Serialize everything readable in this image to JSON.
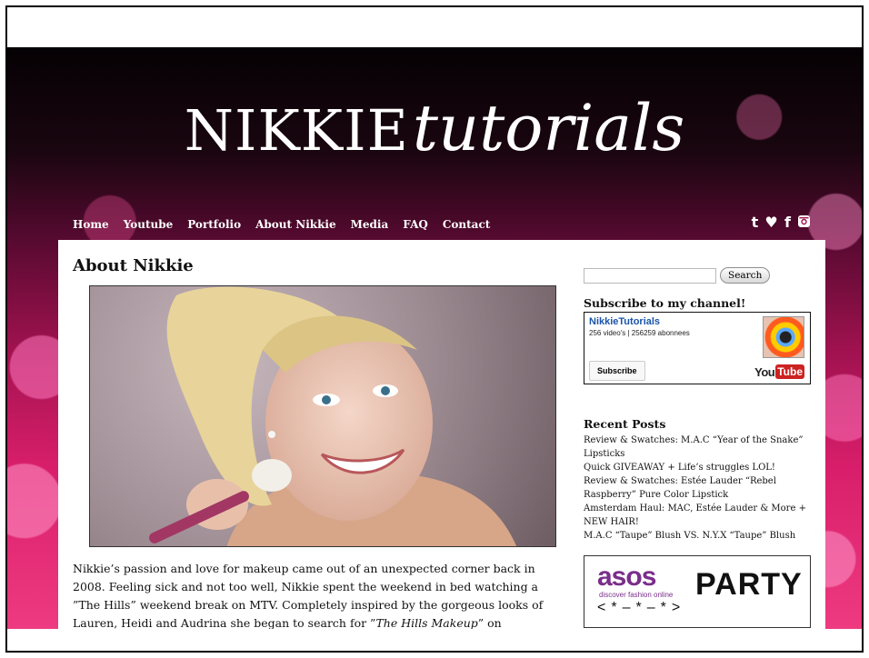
{
  "header": {
    "logo_caps": "NIKKIE",
    "logo_script": "tutorials"
  },
  "nav": [
    "Home",
    "Youtube",
    "Portfolio",
    "About Nikkie",
    "Media",
    "FAQ",
    "Contact"
  ],
  "social_icons": [
    "tumblr-icon",
    "heart-icon",
    "facebook-icon",
    "instagram-icon"
  ],
  "post": {
    "title": "About Nikkie",
    "body_intro": "Nikkie’s passion and love for makeup came out of an unexpected corner back in 2008. Feeling sick and not too well, Nikkie spent the weekend in bed watching a ”The Hills” weekend break on MTV. Completely inspired by the gorgeous looks of Lauren, Heidi and Audrina she began to search for ”",
    "body_italic": "The Hills Makeup",
    "body_end": "” on YouTube."
  },
  "sidebar": {
    "search_button": "Search",
    "subscribe_title": "Subscribe to my channel!",
    "youtube": {
      "channel_name": "NikkieTutorials",
      "stats": "256 video's | 256259 abonnees",
      "subscribe_label": "Subscribe",
      "logo_you": "You",
      "logo_tube": "Tube"
    },
    "recent_title": "Recent Posts",
    "recent_posts": [
      "Review & Swatches: M.A.C “Year of the Snake” Lipsticks",
      "Quick GIVEAWAY + Life’s struggles LOL!",
      "Review & Swatches: Estée Lauder “Rebel Raspberry” Pure Color Lipstick",
      "Amsterdam Haul: MAC, Estée Lauder & More + NEW HAIR!",
      "M.A.C “Taupe” Blush VS. N.Y.X “Taupe” Blush"
    ],
    "ad": {
      "brand": "asos",
      "tagline": "discover fashion online",
      "headline": "PARTY"
    }
  }
}
